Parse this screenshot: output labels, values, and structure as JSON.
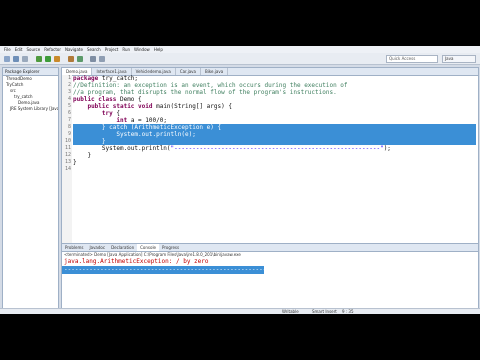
{
  "menu": [
    "File",
    "Edit",
    "Source",
    "Refactor",
    "Navigate",
    "Search",
    "Project",
    "Run",
    "Window",
    "Help"
  ],
  "toolbar": {
    "quick_access": "Quick Access",
    "perspective": "Java"
  },
  "explorer": {
    "tab": "Package Explorer",
    "items": [
      "ThreadDemo",
      "TryCatch",
      "src",
      "try_catch",
      "Demo.java",
      "JRE System Library [JavaSE-1.8]"
    ]
  },
  "editor": {
    "tabs": [
      "Demo.java",
      "Interface1.java",
      "Vehicledemo.java",
      "Car.java",
      "Bike.java"
    ],
    "line_numbers": [
      "1",
      "2",
      "3",
      "4",
      "5",
      "6",
      "7",
      "8",
      "9",
      "10",
      "11",
      "12",
      "13",
      "14"
    ],
    "lines": {
      "l1_kw": "package",
      "l1_rest": " try_catch;",
      "l2": "//Definition: an exception is an event, which occurs during the execution of",
      "l3": "//a program, that disrupts the normal flow of the program's instructions.",
      "l4_kw": "public class",
      "l4_rest": " Demo {",
      "l5_indent": "    ",
      "l5_kw": "public static void",
      "l5_rest": " main(String[] args) {",
      "l6_indent": "        ",
      "l6_kw": "try",
      "l6_rest": " {",
      "l7_indent": "            ",
      "l7_kw": "int",
      "l7_rest": " a = 100/0;",
      "l8": "        } catch (ArithmeticException e) {",
      "l9": "            System.out.println(e);",
      "l10": "        }",
      "l11_a": "        System.out.println(",
      "l11_str": "\"---------------------------------------------------------\"",
      "l11_b": ");",
      "l12": "    }",
      "l13": "}",
      "l14": ""
    }
  },
  "console": {
    "tabs": [
      "Problems",
      "Javadoc",
      "Declaration",
      "Console",
      "Progress"
    ],
    "terminated": "<terminated> Demo [Java Application] C:\\Program Files\\Java\\jre1.8.0_201\\bin\\javaw.exe",
    "line1": "java.lang.ArithmeticException: / by zero",
    "line2": "---------------------------------------------------------"
  },
  "status": {
    "writable": "Writable",
    "insert": "Smart Insert",
    "position": "9 : 35"
  }
}
